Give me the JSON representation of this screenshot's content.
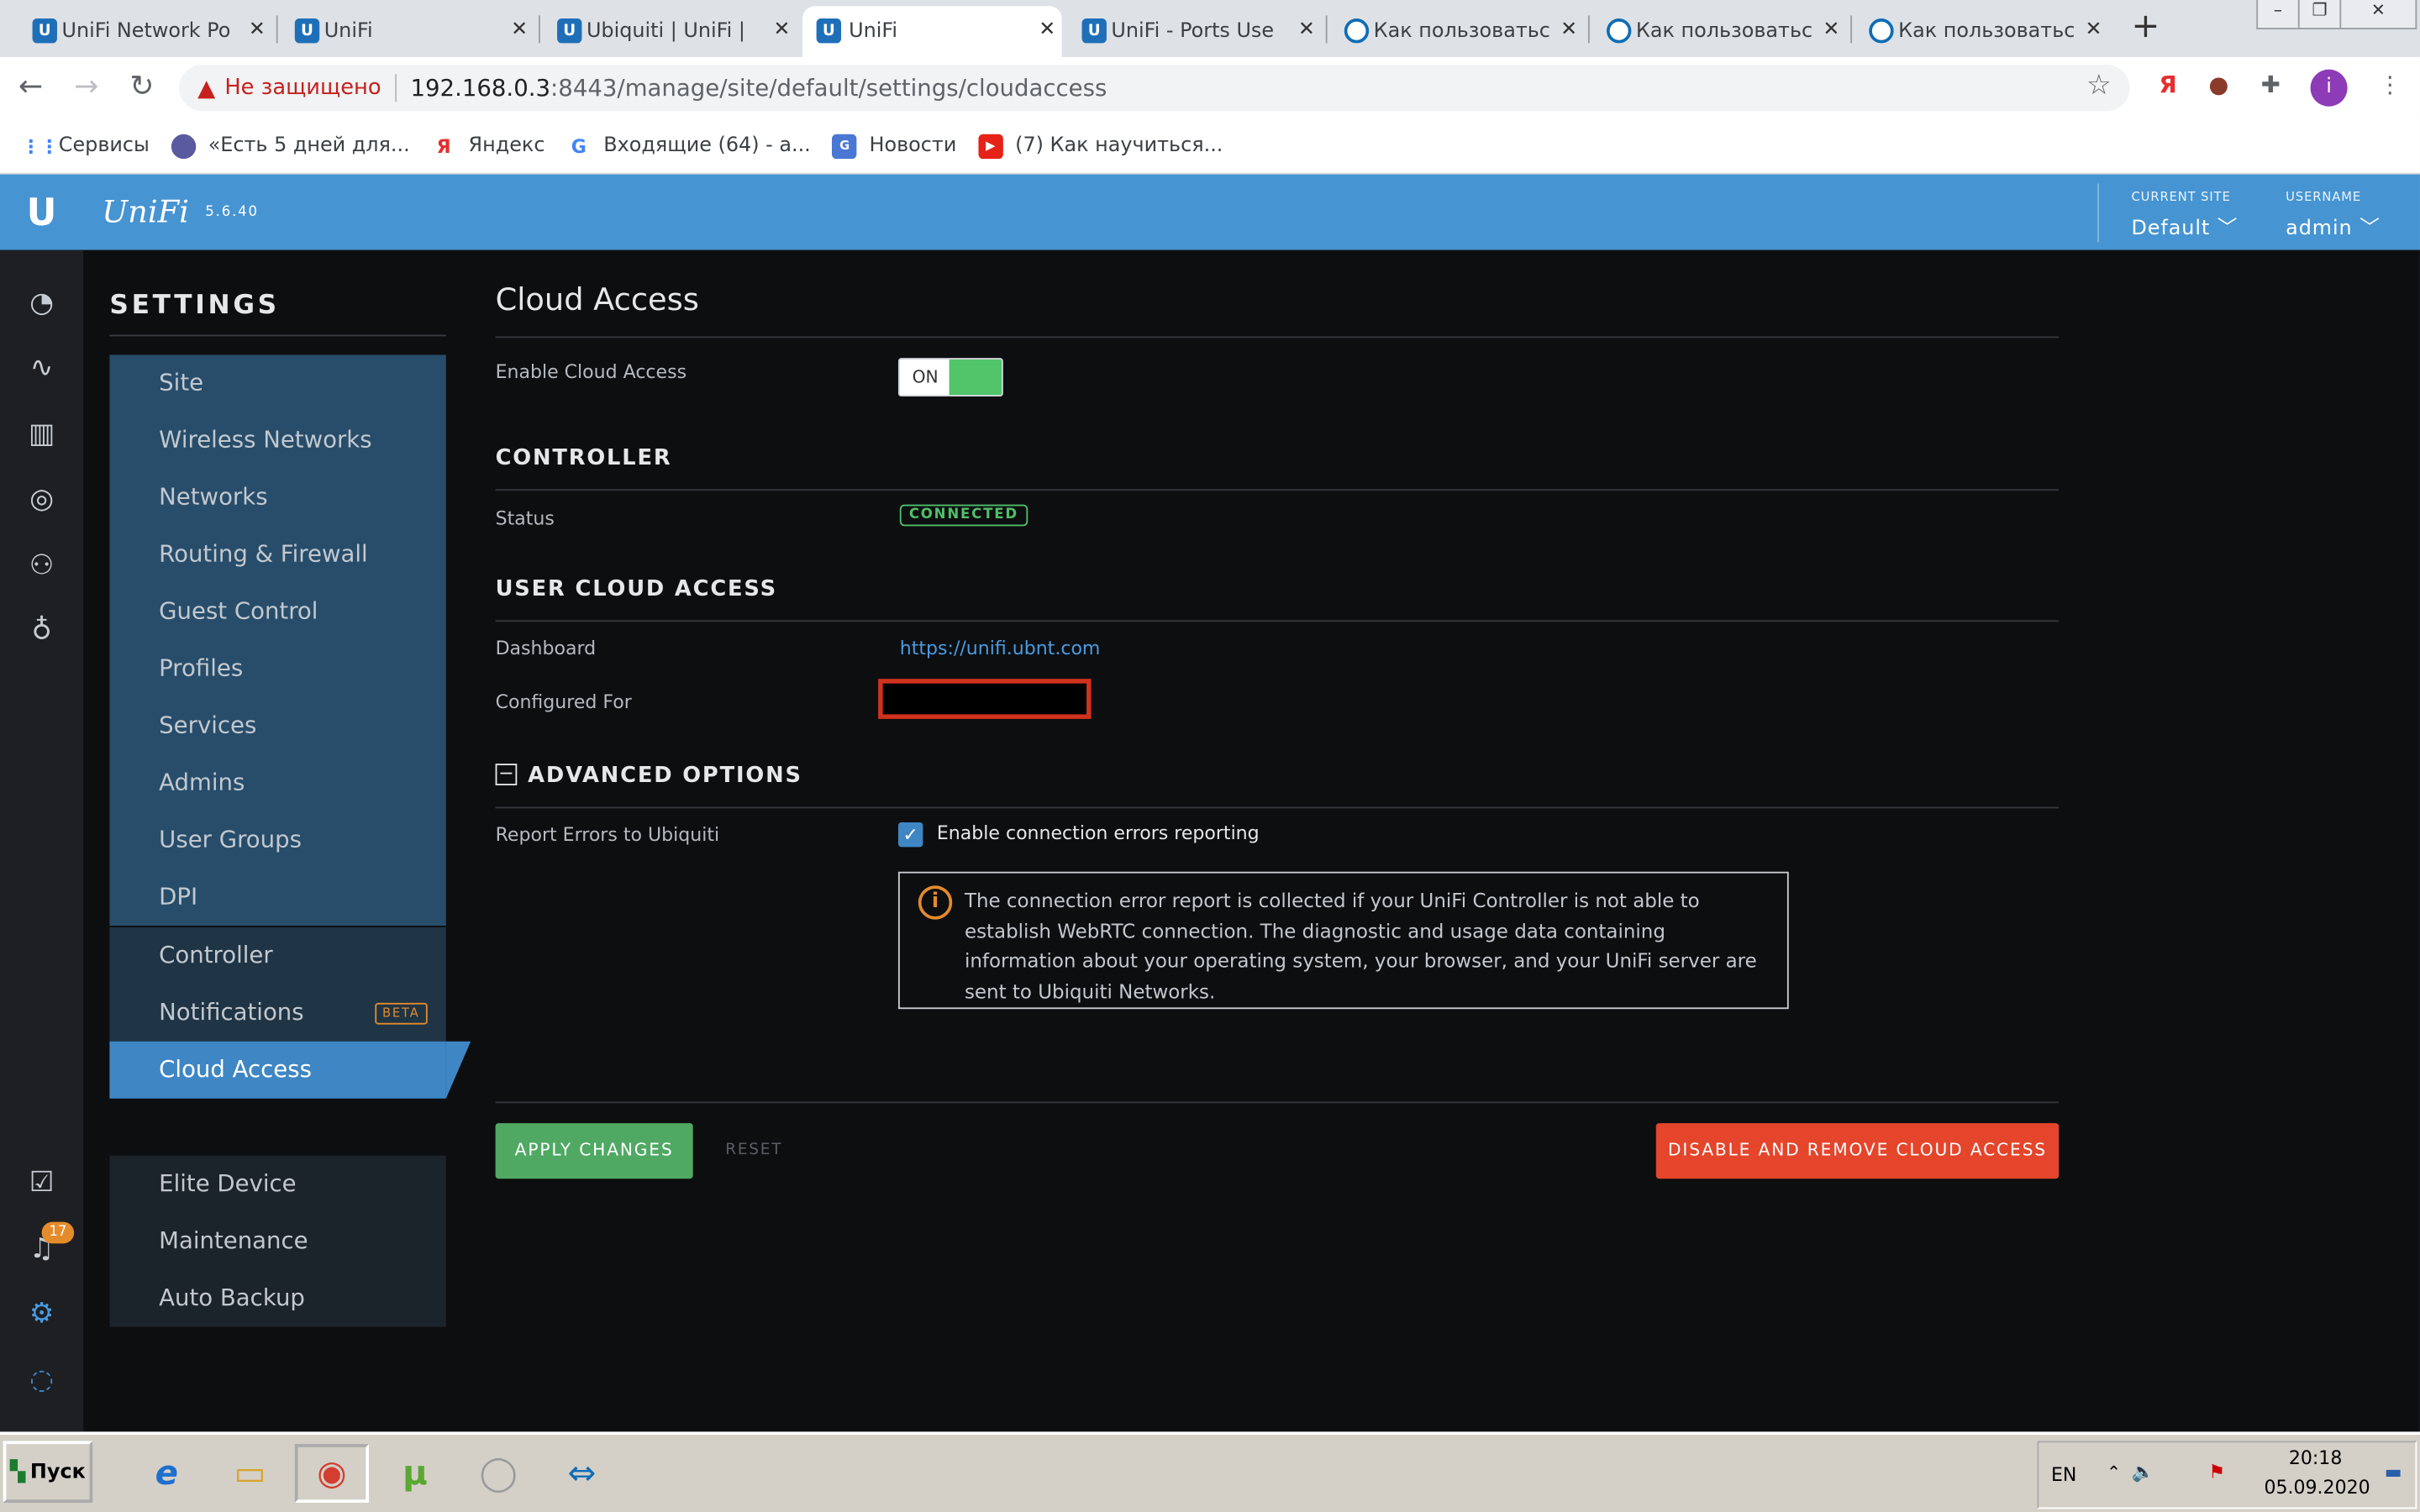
{
  "browser": {
    "tabs": [
      {
        "title": "UniFi Network Po",
        "icon": "unifi-icon"
      },
      {
        "title": "UniFi",
        "icon": "unifi-icon"
      },
      {
        "title": "Ubiquiti | UniFi |  ",
        "icon": "unifi-icon"
      },
      {
        "title": "UniFi",
        "icon": "unifi-icon",
        "active": true
      },
      {
        "title": "UniFi - Ports Use",
        "icon": "unifi-icon"
      },
      {
        "title": "Как пользоватьс",
        "icon": "teamviewer-icon"
      },
      {
        "title": "Как пользоватьс",
        "icon": "teamviewer-icon"
      },
      {
        "title": "Как пользоватьс",
        "icon": "teamviewer-icon"
      }
    ],
    "security_label": "Не защищено",
    "url_host": "192.168.0.3",
    "url_rest": ":8443/manage/site/default/settings/cloudaccess",
    "profile_initial": "i",
    "bookmarks": [
      {
        "label": "Сервисы",
        "icon": "apps-grid-icon"
      },
      {
        "label": "«Есть 5 дней для...",
        "icon": "bookmark-site-icon"
      },
      {
        "label": "Яндекс",
        "icon": "yandex-icon"
      },
      {
        "label": "Входящие (64) - a...",
        "icon": "google-icon"
      },
      {
        "label": "Новости",
        "icon": "news-icon"
      },
      {
        "label": "(7) Как научиться...",
        "icon": "youtube-icon"
      }
    ]
  },
  "header": {
    "app_name": "UniFi",
    "version": "5.6.40",
    "current_site_label": "CURRENT SITE",
    "current_site_value": "Default",
    "username_label": "USERNAME",
    "username_value": "admin",
    "brand_color": "#4694d2"
  },
  "sidebar": {
    "title": "SETTINGS",
    "group1": [
      "Site",
      "Wireless Networks",
      "Networks",
      "Routing & Firewall",
      "Guest Control",
      "Profiles",
      "Services",
      "Admins",
      "User Groups",
      "DPI"
    ],
    "group2": [
      "Controller",
      "Notifications"
    ],
    "beta_label": "BETA",
    "active_item": "Cloud Access",
    "group3": [
      "Elite Device",
      "Maintenance",
      "Auto Backup"
    ],
    "notification_count": "17"
  },
  "content": {
    "title": "Cloud Access",
    "enable_label": "Enable Cloud Access",
    "toggle_label": "ON",
    "controller_section": "CONTROLLER",
    "status_label": "Status",
    "status_value": "CONNECTED",
    "user_section": "USER CLOUD ACCESS",
    "dashboard_label": "Dashboard",
    "dashboard_link": "https://unifi.ubnt.com",
    "configured_label": "Configured For",
    "advanced_section": "ADVANCED OPTIONS",
    "report_label": "Report Errors to Ubiquiti",
    "report_checkbox_label": "Enable connection errors reporting",
    "info_text": "The connection error report is collected if your UniFi Controller is not able to establish WebRTC connection. The diagnostic and usage data containing information about your operating system, your browser, and your UniFi server are sent to Ubiquiti Networks.",
    "apply_button": "APPLY CHANGES",
    "reset_button": "RESET",
    "disable_button": "DISABLE AND REMOVE CLOUD ACCESS"
  },
  "taskbar": {
    "start_label": "Пуск",
    "language": "EN",
    "time": "20:18",
    "date": "05.09.2020"
  }
}
